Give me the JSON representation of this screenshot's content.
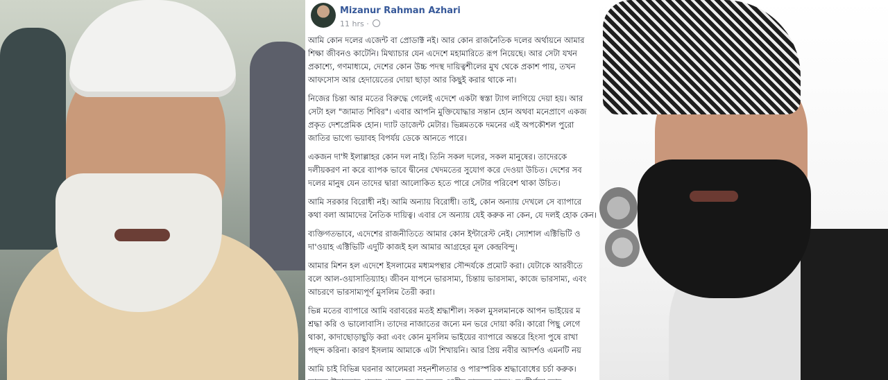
{
  "post": {
    "author": "Mizanur Rahman Azhari",
    "time": "11 hrs",
    "separator": "·",
    "paragraphs": [
      "আমি কোন দলের এজেন্ট বা প্রোডাক্ট নই। আর কোন রাজনৈতিক দলের অর্থায়নে আমার শিক্ষা জীবনও কাটেনি। মিথ্যাচার যেন এদেশে মহামারিতে রূপ নিয়েছে। আর সেটা যখন প্রকাশ্যে, গণমাধ্যমে, দেশের কোন উচ্চ পদস্থ দায়িত্বশীলের মুখ থেকে প্রকাশ পায়, তখন আফসোস আর হেদায়েতের দোয়া ছাড়া আর কিছুই করার থাকে না।",
      "নিজের চিন্তা আর মতের বিরুদ্ধে গেলেই এদেশে একটা স্বস্তা ট্যাগ লাগিয়ে দেয়া হয়। আর সেটা হল \"জামাত শিবির\"। এবার আপনি মুক্তিযোদ্ধার সন্তান হোন অথবা মনেপ্রাণে একজ প্রকৃত দেশপ্রেমিক হোন। দ্যাট ডাজেন্ট মেটার। ভিন্নমতকে দমনের এই অপকৌশল পুরো জাতির ভাগ্যে ভয়াবহ বিপর্যয় ডেকে আনতে পারে।",
      "একজন দা'ঈ ইলাল্লাহর কোন দল নাই। তিনি সকল দলের, সকল মানুষের। তাদেরকে দলীয়করণ না করে ব্যাপক ভাবে দ্বীনের খেদমতের সুযোগ করে দেওয়া উচিত। দেশের সব দলের মানুষ যেন তাদের দ্বারা আলোকিত হতে পারে সেটার পরিবেশ থাকা উচিত।",
      "আমি সরকার বিরোধী নই। আমি অন্যায় বিরোধী। তাই, কোন অন্যায় দেখলে সে ব্যাপারে কথা বলা আমাদের নৈতিক দায়িত্ব। এবার সে অন্যায় যেই করুক না কেন, যে দলই হোক কেন।",
      "ব্যক্তিগতভাবে, এদেশের রাজনীতিতে আমার কোন ইন্টারেস্ট নেই। স্যোশাল এক্টিভিটি ও দা'ওয়াহ এক্টিভিটি এদুটি কাজই হল আমার আগ্রহের মূল কেন্দ্রবিন্দু।",
      "আমার মিশন হল এদেশে ইসলামের মধ্যমপন্থার সৌন্দর্যকে প্রমোট করা। যেটাকে আরবীতে বলে আল-ওয়াসাতিয়্যাহ। জীবন যাপনে ভারসাম্য, চিন্তায় ভারসাম্য, কাজে ভারসাম্য, এবং আচরণে ভারসাম্যপূর্ণ মুসলিম তৈরী করা।",
      "ভিন্ন মতের ব্যাপারে আমি বরাবরের মতই শ্রদ্ধাশীল। সকল মুসলমানকে আপন ভাইয়ের ম শ্রদ্ধা করি ও ভালোবাসি। তাদের নাজাতের জন্যে মন ভরে দোয়া করি। কারো পিছু লেগে থাকা, কাদাছোড়াছুড়ি করা এবং কোন মুসলিম ভাইয়ের ব্যাপারে অন্তরে হিংসা পুষে রাখা পছন্দ করিনা। কারণ ইসলাম আমাকে এটা শিখায়নি। আর প্রিয় নবীর আদর্শও এমনটি নয়",
      "আমি চাই বিভিন্ন ঘরনার আলেমরা সহনশীলতার ও পারস্পরিক শ্রদ্ধাবোধের চর্চা করুক। তাদের উদারতার প্রভাব পড়ুক দেশের সকল শ্রেণীর মানুষের মাঝে। সংকীর্ণতা আর"
    ]
  }
}
